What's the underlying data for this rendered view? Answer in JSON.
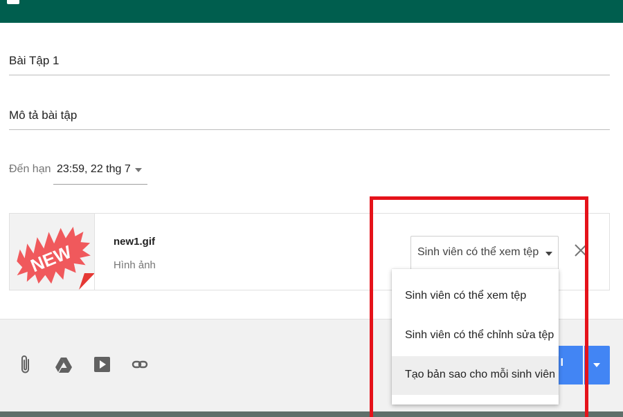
{
  "header": {
    "color": "#005e4e"
  },
  "form": {
    "title_value": "Bài Tập 1",
    "description_placeholder": "Mô tả bài tập",
    "due": {
      "label": "Đến hạn",
      "value": "23:59, 22 thg 7"
    }
  },
  "attachment": {
    "thumbnail_text": "NEW",
    "name": "new1.gif",
    "type": "Hình ảnh",
    "permission": "Sinh viên có thể xem tệp"
  },
  "permission_menu": {
    "options": [
      "Sinh viên có thể xem tệp",
      "Sinh viên có thể chỉnh sửa tệp",
      "Tạo bản sao cho mỗi sinh viên"
    ],
    "highlighted": "Tạo bản sao cho mỗi sinh viên"
  },
  "toolbar": {
    "icons": [
      "paperclip-icon",
      "drive-icon",
      "youtube-icon",
      "link-icon"
    ]
  },
  "assign_button": {
    "label": "I",
    "color": "#4285f4"
  },
  "annotation": {
    "color": "#e5121a"
  }
}
